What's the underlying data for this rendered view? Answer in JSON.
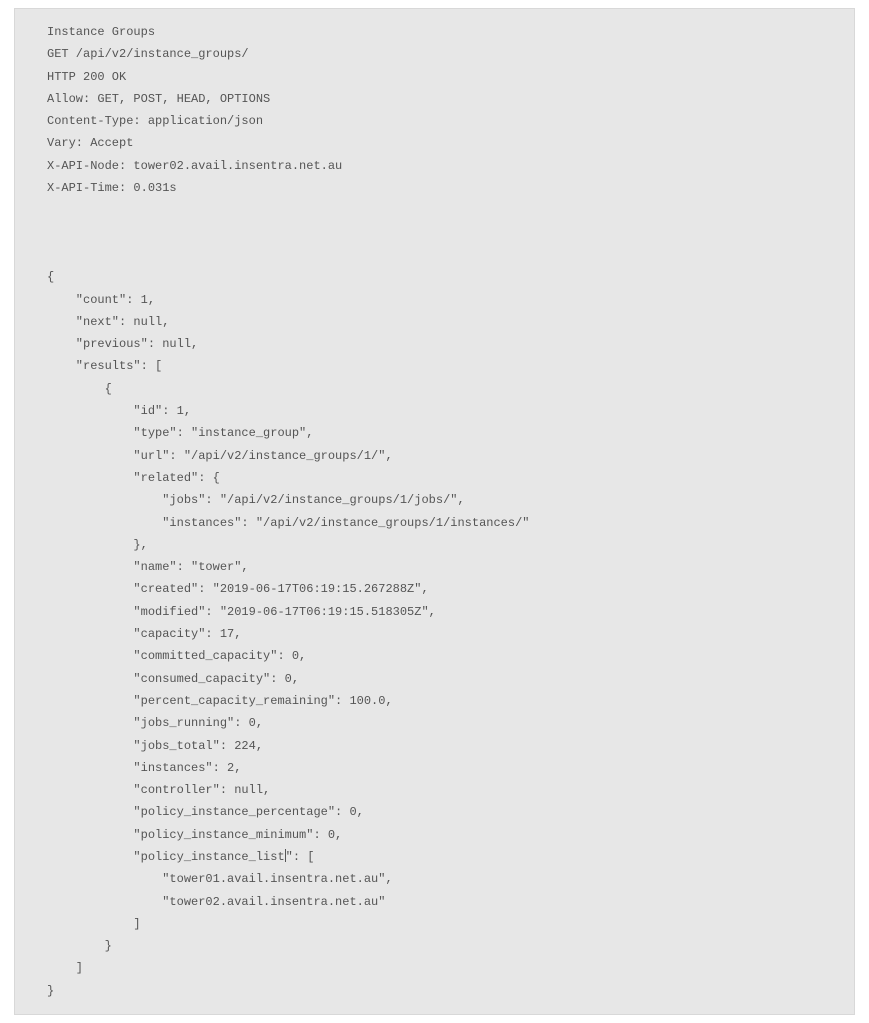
{
  "api": {
    "title": "Instance Groups",
    "request_line": "GET /api/v2/instance_groups/",
    "status_line": "HTTP 200 OK",
    "headers": {
      "allow": "Allow: GET, POST, HEAD, OPTIONS",
      "content_type": "Content-Type: application/json",
      "vary": "Vary: Accept",
      "x_api_node": "X-API-Node: tower02.avail.insentra.net.au",
      "x_api_time": "X-API-Time: 0.031s"
    },
    "body": {
      "open": "{",
      "count": "    \"count\": 1,",
      "next": "    \"next\": null,",
      "previous": "    \"previous\": null,",
      "results_open": "    \"results\": [",
      "item_open": "        {",
      "id": "            \"id\": 1,",
      "type": "            \"type\": \"instance_group\",",
      "url": "            \"url\": \"/api/v2/instance_groups/1/\",",
      "related_open": "            \"related\": {",
      "related_jobs": "                \"jobs\": \"/api/v2/instance_groups/1/jobs/\",",
      "related_instances": "                \"instances\": \"/api/v2/instance_groups/1/instances/\"",
      "related_close": "            },",
      "name": "            \"name\": \"tower\",",
      "created": "            \"created\": \"2019-06-17T06:19:15.267288Z\",",
      "modified": "            \"modified\": \"2019-06-17T06:19:15.518305Z\",",
      "capacity": "            \"capacity\": 17,",
      "committed_capacity": "            \"committed_capacity\": 0,",
      "consumed_capacity": "            \"consumed_capacity\": 0,",
      "percent_capacity_remaining": "            \"percent_capacity_remaining\": 100.0,",
      "jobs_running": "            \"jobs_running\": 0,",
      "jobs_total": "            \"jobs_total\": 224,",
      "instances": "            \"instances\": 2,",
      "controller": "            \"controller\": null,",
      "policy_instance_percentage": "            \"policy_instance_percentage\": 0,",
      "policy_instance_minimum": "            \"policy_instance_minimum\": 0,",
      "policy_instance_list_key_a": "            \"policy_instance_list",
      "policy_instance_list_key_b": "\": [",
      "pil_1": "                \"tower01.avail.insentra.net.au\",",
      "pil_2": "                \"tower02.avail.insentra.net.au\"",
      "pil_close": "            ]",
      "item_close": "        }",
      "results_close": "    ]",
      "close": "}"
    }
  }
}
